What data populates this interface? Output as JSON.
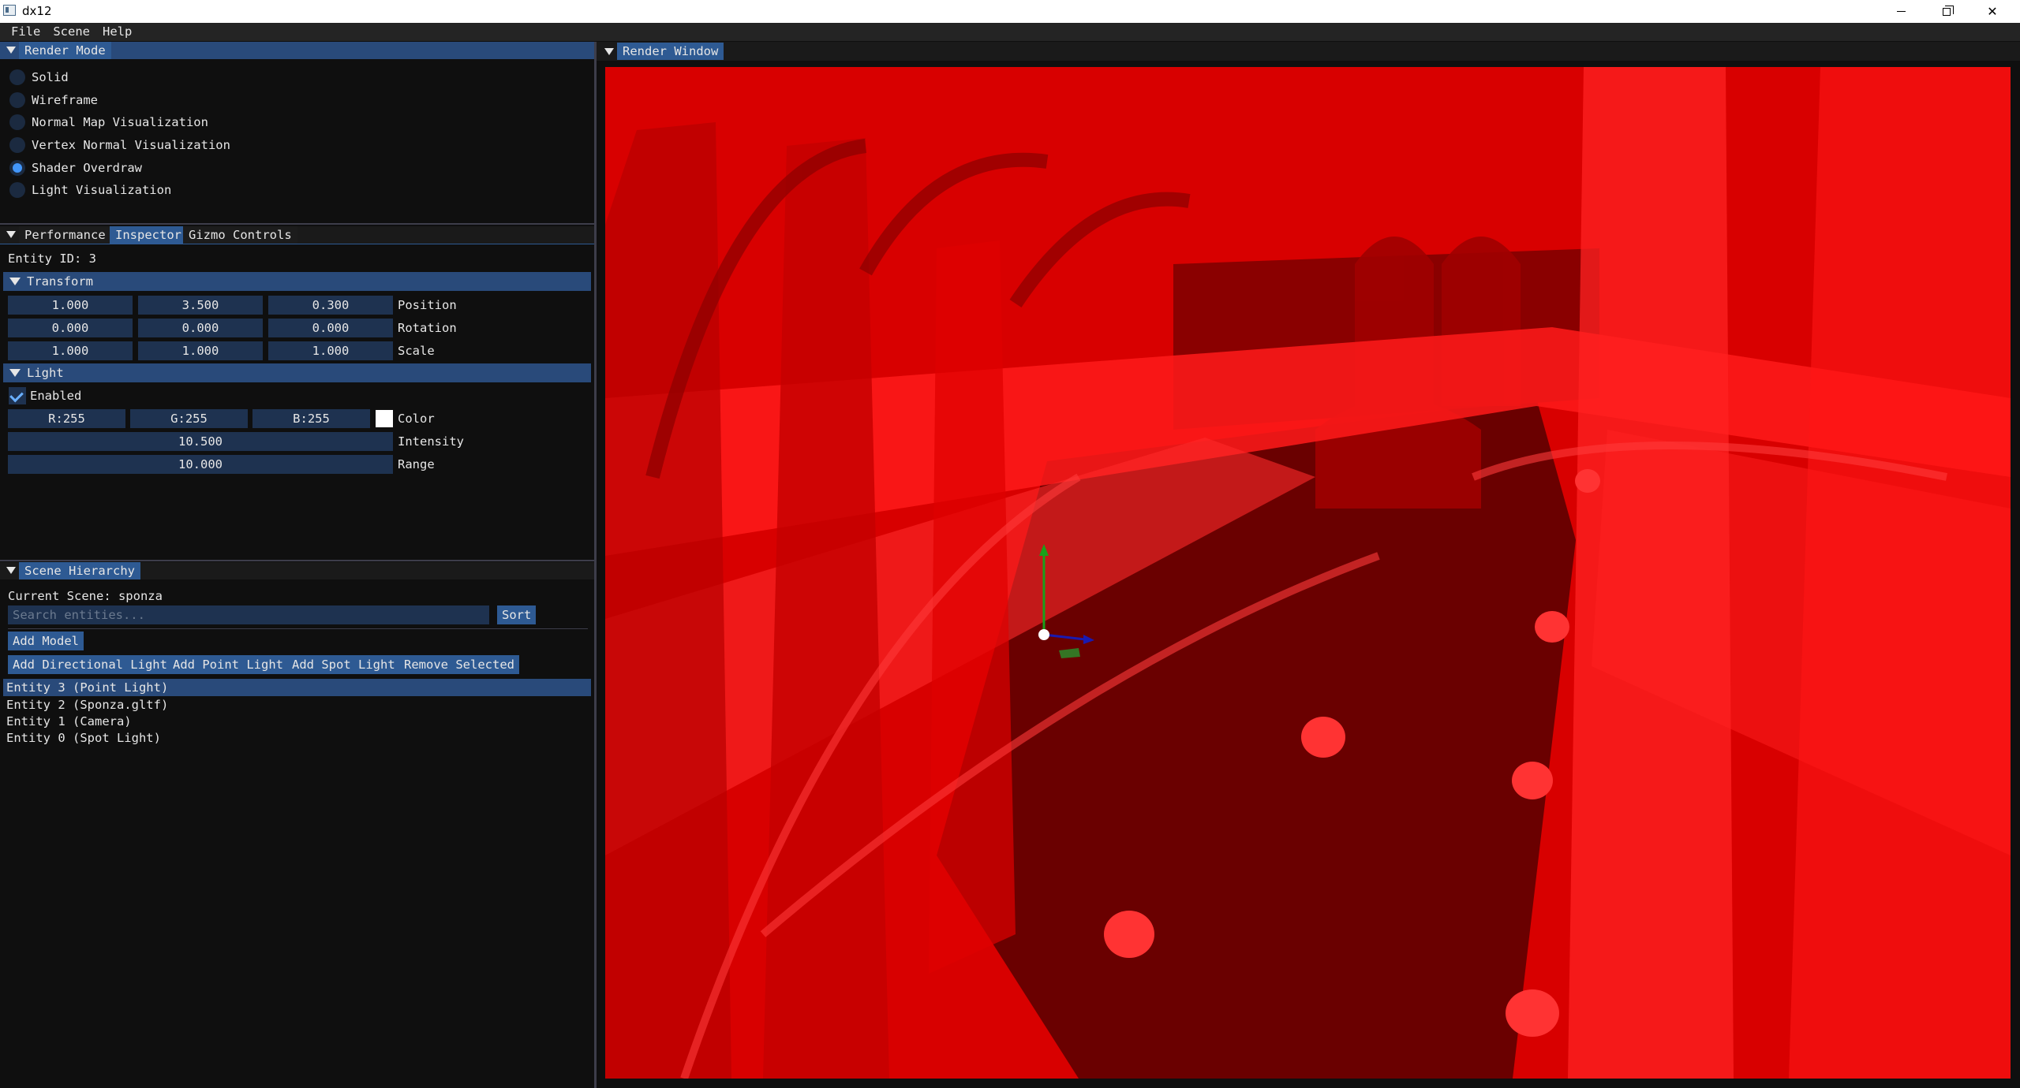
{
  "window": {
    "title": "dx12"
  },
  "menu": [
    "File",
    "Scene",
    "Help"
  ],
  "render_mode": {
    "tab": "Render Mode",
    "options": [
      {
        "label": "Solid",
        "selected": false
      },
      {
        "label": "Wireframe",
        "selected": false
      },
      {
        "label": "Normal Map Visualization",
        "selected": false
      },
      {
        "label": "Vertex Normal Visualization",
        "selected": false
      },
      {
        "label": "Shader Overdraw",
        "selected": true
      },
      {
        "label": "Light Visualization",
        "selected": false
      }
    ]
  },
  "inspector": {
    "tabs": [
      "Performance",
      "Inspector",
      "Gizmo Controls"
    ],
    "active_tab": "Inspector",
    "entity_id_label": "Entity ID: 3",
    "transform": {
      "header": "Transform",
      "position": {
        "x": "1.000",
        "y": "3.500",
        "z": "0.300",
        "label": "Position"
      },
      "rotation": {
        "x": "0.000",
        "y": "0.000",
        "z": "0.000",
        "label": "Rotation"
      },
      "scale": {
        "x": "1.000",
        "y": "1.000",
        "z": "1.000",
        "label": "Scale"
      }
    },
    "light": {
      "header": "Light",
      "enabled_label": "Enabled",
      "enabled": true,
      "color": {
        "r": "R:255",
        "g": "G:255",
        "b": "B:255",
        "label": "Color",
        "swatch": "#ffffff"
      },
      "intensity": {
        "value": "10.500",
        "label": "Intensity"
      },
      "range": {
        "value": "10.000",
        "label": "Range"
      }
    }
  },
  "hierarchy": {
    "tab": "Scene Hierarchy",
    "current_scene": "Current Scene: sponza",
    "search_placeholder": "Search entities...",
    "sort_label": "Sort",
    "add_model_label": "Add Model",
    "buttons": [
      "Add Directional Light",
      "Add Point Light",
      "Add Spot Light",
      "Remove Selected"
    ],
    "entities": [
      {
        "label": "Entity 3 (Point Light)",
        "selected": true
      },
      {
        "label": "Entity 2 (Sponza.gltf)",
        "selected": false
      },
      {
        "label": "Entity 1 (Camera)",
        "selected": false
      },
      {
        "label": "Entity 0 (Spot Light)",
        "selected": false
      }
    ]
  },
  "render_window": {
    "tab": "Render Window"
  },
  "colors": {
    "accent": "#2e5a93",
    "header": "#294a7a",
    "overdraw_red": "#d40000",
    "frame_field": "#1e3250"
  }
}
